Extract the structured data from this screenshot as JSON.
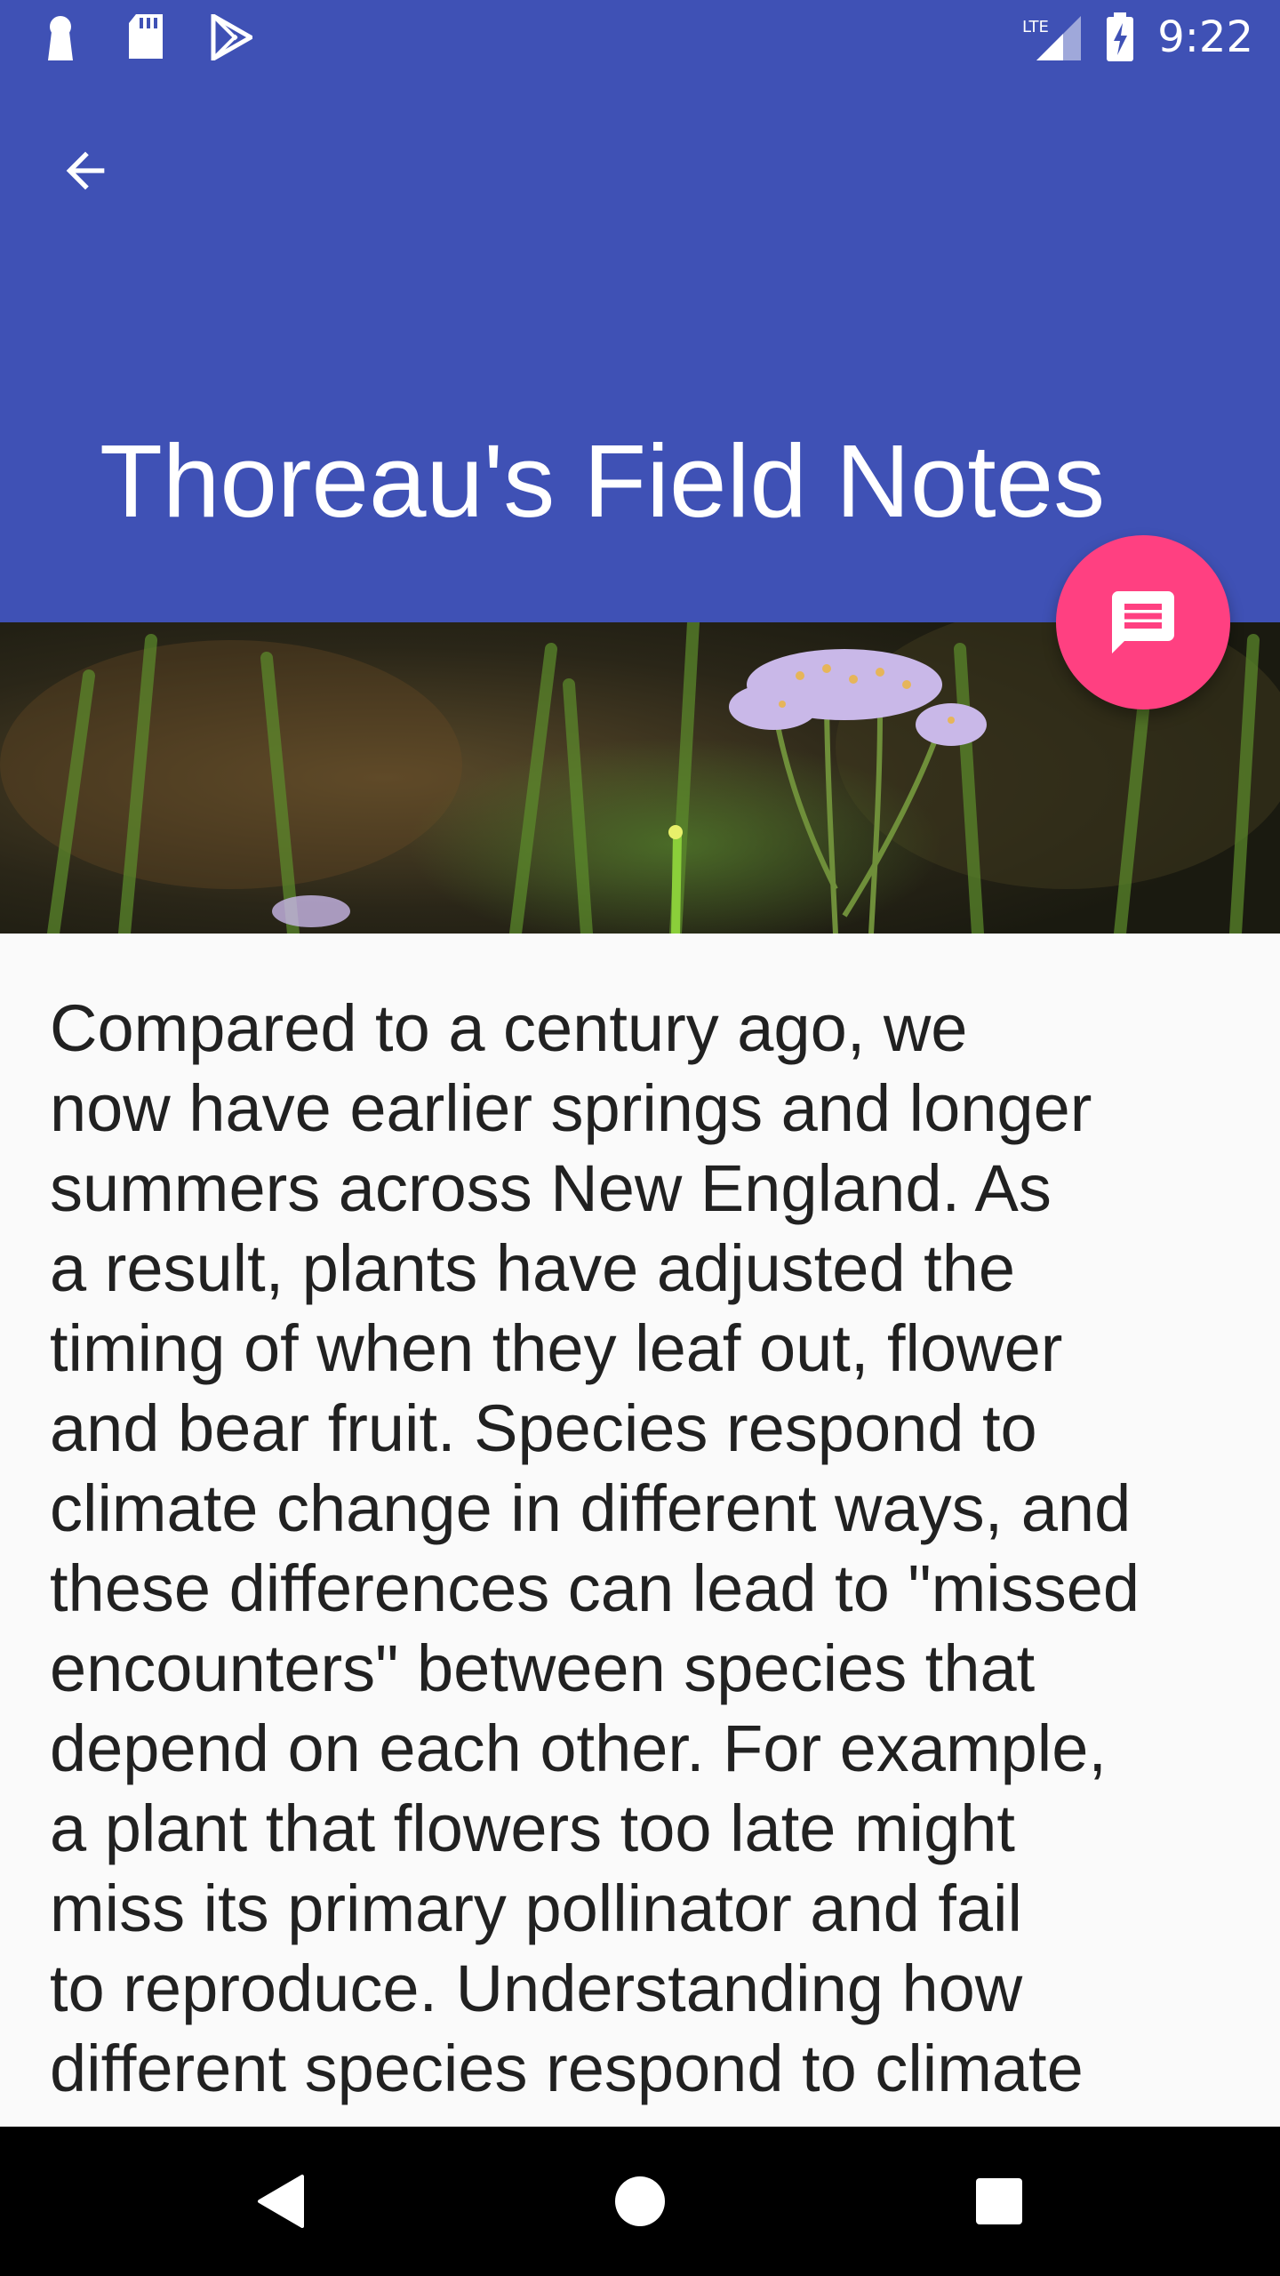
{
  "status_bar": {
    "time": "9:22",
    "network": "LTE",
    "icons_left": [
      "keyhole-icon",
      "sd-card-icon",
      "play-store-icon"
    ],
    "icons_right": [
      "lte-signal-icon",
      "battery-charging-icon"
    ]
  },
  "header": {
    "title": "Thoreau's Field Notes",
    "background_color": "#3f51b5",
    "back_icon": "arrow-back-icon"
  },
  "fab": {
    "icon": "message-icon",
    "color": "#ff4081"
  },
  "article": {
    "lines": [
      "Compared to a century ago, we",
      "now have earlier springs and longer",
      "summers across New England. As",
      "a result, plants have adjusted the",
      "timing of when they leaf out, flower",
      "and bear fruit. Species respond to",
      "climate change in different ways, and",
      "these differences can lead to \"missed",
      "encounters\" between species that",
      "depend on each other. For example,",
      "a plant that flowers too late might",
      "miss its primary pollinator and fail",
      "to reproduce. Understanding how",
      "different species respond to climate"
    ]
  },
  "nav_bar": {
    "buttons": [
      "back-triangle-icon",
      "home-circle-icon",
      "recents-square-icon"
    ]
  }
}
